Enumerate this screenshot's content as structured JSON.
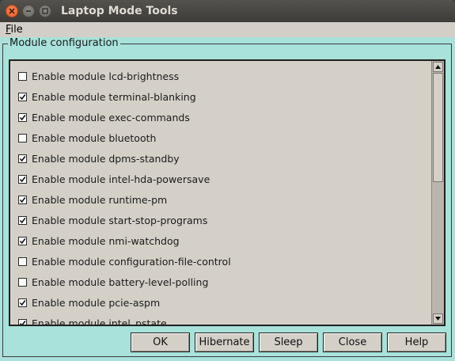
{
  "window": {
    "title": "Laptop Mode Tools",
    "controls": [
      "close-icon",
      "minimize-icon",
      "maximize-icon"
    ]
  },
  "menubar": {
    "file_mnemonic": "F",
    "file_rest": "ile"
  },
  "group": {
    "label": "Module configuration"
  },
  "modules": [
    {
      "label": "Enable module lcd-brightness",
      "checked": false
    },
    {
      "label": "Enable module terminal-blanking",
      "checked": true
    },
    {
      "label": "Enable module exec-commands",
      "checked": true
    },
    {
      "label": "Enable module bluetooth",
      "checked": false
    },
    {
      "label": "Enable module dpms-standby",
      "checked": true
    },
    {
      "label": "Enable module intel-hda-powersave",
      "checked": true
    },
    {
      "label": "Enable module runtime-pm",
      "checked": true
    },
    {
      "label": "Enable module start-stop-programs",
      "checked": true
    },
    {
      "label": "Enable module nmi-watchdog",
      "checked": true
    },
    {
      "label": "Enable module configuration-file-control",
      "checked": false
    },
    {
      "label": "Enable module battery-level-polling",
      "checked": false
    },
    {
      "label": "Enable module pcie-aspm",
      "checked": true
    },
    {
      "label": "Enable module intel_pstate",
      "checked": true
    }
  ],
  "buttons": {
    "ok": "OK",
    "hibernate": "Hibernate",
    "sleep": "Sleep",
    "close": "Close",
    "help": "Help"
  }
}
